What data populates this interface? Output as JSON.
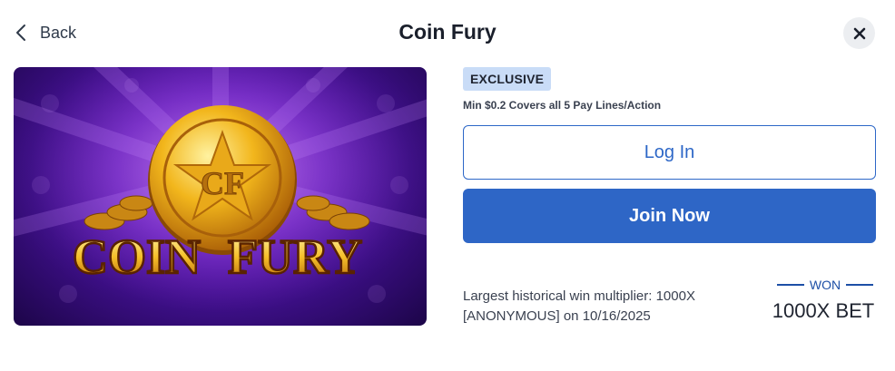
{
  "header": {
    "back_label": "Back",
    "title": "Coin Fury",
    "close_icon": "close-icon",
    "back_icon": "chevron-left-icon"
  },
  "game": {
    "image_title_word1": "COIN",
    "image_title_word2": "FURY",
    "coin_monogram": "CF",
    "badge": "EXCLUSIVE",
    "min_bet_text": "Min $0.2 Covers all 5 Pay Lines/Action"
  },
  "actions": {
    "login_label": "Log In",
    "join_label": "Join Now"
  },
  "win": {
    "line1": "Largest historical win multiplier: 1000X",
    "line2": "[ANONYMOUS] on 10/16/2025",
    "won_label": "WON",
    "won_value": "1000X BET"
  },
  "colors": {
    "primary": "#2e66c6",
    "badge_bg": "#c9dcf7",
    "text": "#1f2430"
  }
}
